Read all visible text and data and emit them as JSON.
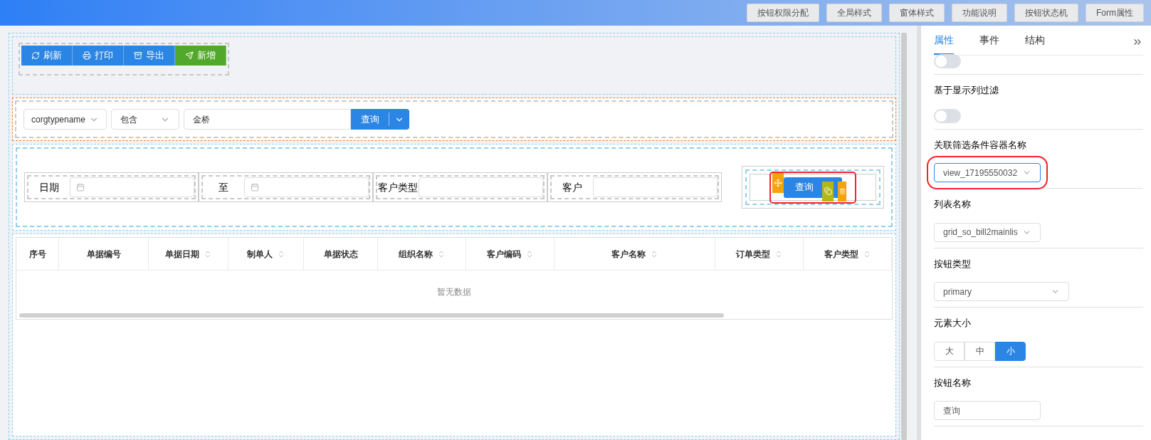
{
  "top_toolbar": {
    "buttons": [
      "按钮权限分配",
      "全局样式",
      "窗体样式",
      "功能说明",
      "按钮状态机",
      "Form属性"
    ]
  },
  "action_buttons": [
    {
      "label": "刷新",
      "color": "#2b85e4"
    },
    {
      "label": "打印",
      "color": "#2b85e4"
    },
    {
      "label": "导出",
      "color": "#2b85e4"
    },
    {
      "label": "新增",
      "color": "#52a82b"
    }
  ],
  "filter_bar": {
    "field": "corgtypename",
    "operator": "包含",
    "value": "金桥",
    "search_button": "查询"
  },
  "query_form": {
    "fields": [
      {
        "label": "日期",
        "kind": "date"
      },
      {
        "label": "至",
        "kind": "date"
      },
      {
        "label": "客户类型",
        "kind": "text"
      },
      {
        "label": "客户",
        "kind": "text"
      }
    ],
    "query_button": {
      "label": "查询",
      "selected": true
    }
  },
  "table": {
    "columns": [
      {
        "label": "序号",
        "sortable": false
      },
      {
        "label": "单据编号",
        "sortable": false
      },
      {
        "label": "单据日期",
        "sortable": true
      },
      {
        "label": "制单人",
        "sortable": true
      },
      {
        "label": "单据状态",
        "sortable": false
      },
      {
        "label": "组织名称",
        "sortable": true
      },
      {
        "label": "客户编码",
        "sortable": true
      },
      {
        "label": "客户名称",
        "sortable": true
      },
      {
        "label": "订单类型",
        "sortable": true
      },
      {
        "label": "客户类型",
        "sortable": true
      }
    ],
    "empty_text": "暂无数据"
  },
  "properties_panel": {
    "tabs": [
      {
        "label": "属性",
        "selected": true
      },
      {
        "label": "事件",
        "selected": false
      },
      {
        "label": "结构",
        "selected": false
      }
    ],
    "items": [
      {
        "kind": "toggle",
        "on": false
      },
      {
        "kind": "toggle",
        "label": "基于显示列过滤",
        "on": false
      },
      {
        "kind": "select",
        "label": "关联筛选条件容器名称",
        "value": "view_17195550032",
        "highlighted": true
      },
      {
        "kind": "select",
        "label": "列表名称",
        "value": "grid_so_bill2mainlis",
        "highlighted": false
      },
      {
        "kind": "select",
        "label": "按钮类型",
        "value": "primary",
        "wide": true,
        "highlighted": false
      },
      {
        "kind": "segmented",
        "label": "元素大小",
        "options": [
          {
            "label": "大",
            "selected": false
          },
          {
            "label": "中",
            "selected": false
          },
          {
            "label": "小",
            "selected": true
          }
        ]
      },
      {
        "kind": "text",
        "label": "按钮名称",
        "value": "查询"
      }
    ]
  }
}
